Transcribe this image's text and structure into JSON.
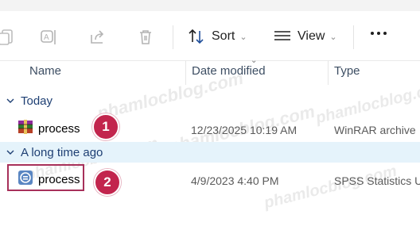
{
  "toolbar": {
    "sort_label": "Sort",
    "view_label": "View",
    "icons": [
      "copy-icon",
      "rename-icon",
      "share-icon",
      "delete-icon",
      "sort-icon",
      "view-icon",
      "more-icon"
    ]
  },
  "columns": {
    "name": "Name",
    "date": "Date modified",
    "type": "Type"
  },
  "groups": [
    {
      "label": "Today",
      "files": [
        {
          "name": "process",
          "date": "12/23/2025 10:19 AM",
          "type": "WinRAR archive",
          "icon": "winrar-icon"
        }
      ]
    },
    {
      "label": "A long time ago",
      "files": [
        {
          "name": "process",
          "date": "4/9/2023 4:40 PM",
          "type": "SPSS Statistics U",
          "icon": "spss-icon"
        }
      ]
    }
  ],
  "annotations": {
    "badge1": "1",
    "badge2": "2",
    "color": "#c2254d"
  },
  "watermark": "phamlocblog.com"
}
